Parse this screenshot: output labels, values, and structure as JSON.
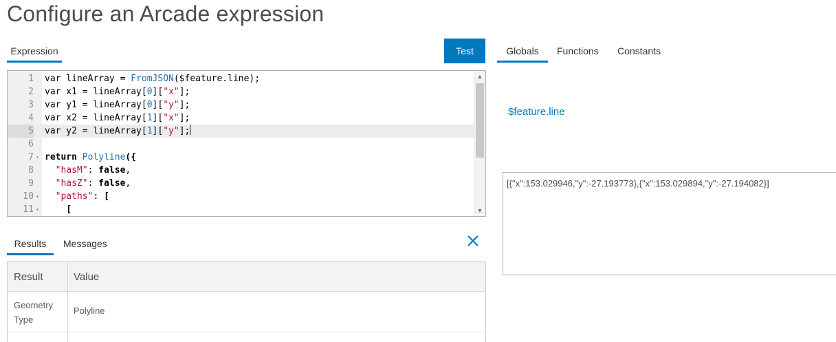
{
  "page": {
    "title": "Configure an Arcade expression"
  },
  "left_tabs": {
    "expression": "Expression",
    "test_button": "Test"
  },
  "editor": {
    "lines": [
      {
        "num": "1",
        "fold": "",
        "tokens": [
          {
            "t": "var lineArray = ",
            "c": ""
          },
          {
            "t": "FromJSON",
            "c": "fn"
          },
          {
            "t": "($feature.line);",
            "c": ""
          }
        ]
      },
      {
        "num": "2",
        "fold": "",
        "tokens": [
          {
            "t": "var x1 = lineArray[",
            "c": ""
          },
          {
            "t": "0",
            "c": "fn"
          },
          {
            "t": "][",
            "c": ""
          },
          {
            "t": "\"x\"",
            "c": "str"
          },
          {
            "t": "];",
            "c": ""
          }
        ]
      },
      {
        "num": "3",
        "fold": "",
        "tokens": [
          {
            "t": "var y1 = lineArray[",
            "c": ""
          },
          {
            "t": "0",
            "c": "fn"
          },
          {
            "t": "][",
            "c": ""
          },
          {
            "t": "\"y\"",
            "c": "str"
          },
          {
            "t": "];",
            "c": ""
          }
        ]
      },
      {
        "num": "4",
        "fold": "",
        "tokens": [
          {
            "t": "var x2 = lineArray[",
            "c": ""
          },
          {
            "t": "1",
            "c": "fn"
          },
          {
            "t": "][",
            "c": ""
          },
          {
            "t": "\"x\"",
            "c": "str"
          },
          {
            "t": "];",
            "c": ""
          }
        ]
      },
      {
        "num": "5",
        "fold": "",
        "current": true,
        "tokens": [
          {
            "t": "var y2 = lineArray[",
            "c": ""
          },
          {
            "t": "1",
            "c": "fn"
          },
          {
            "t": "][",
            "c": ""
          },
          {
            "t": "\"y\"",
            "c": "str"
          },
          {
            "t": "];",
            "c": ""
          }
        ]
      },
      {
        "num": "6",
        "fold": "",
        "tokens": []
      },
      {
        "num": "7",
        "fold": "▾",
        "tokens": [
          {
            "t": "return",
            "c": "kw"
          },
          {
            "t": " ",
            "c": ""
          },
          {
            "t": "Polyline",
            "c": "fn"
          },
          {
            "t": "({",
            "c": "kw"
          }
        ]
      },
      {
        "num": "8",
        "fold": "",
        "tokens": [
          {
            "t": "  ",
            "c": ""
          },
          {
            "t": "\"hasM\"",
            "c": "str"
          },
          {
            "t": ": ",
            "c": ""
          },
          {
            "t": "false",
            "c": "kw"
          },
          {
            "t": ",",
            "c": ""
          }
        ]
      },
      {
        "num": "9",
        "fold": "",
        "tokens": [
          {
            "t": "  ",
            "c": ""
          },
          {
            "t": "\"hasZ\"",
            "c": "str"
          },
          {
            "t": ": ",
            "c": ""
          },
          {
            "t": "false",
            "c": "kw"
          },
          {
            "t": ",",
            "c": ""
          }
        ]
      },
      {
        "num": "10",
        "fold": "▾",
        "tokens": [
          {
            "t": "  ",
            "c": ""
          },
          {
            "t": "\"paths\"",
            "c": "str"
          },
          {
            "t": ": ",
            "c": ""
          },
          {
            "t": "[",
            "c": "kw"
          }
        ]
      },
      {
        "num": "11",
        "fold": "▾",
        "tokens": [
          {
            "t": "    ",
            "c": ""
          },
          {
            "t": "[",
            "c": "kw"
          }
        ]
      }
    ]
  },
  "results_tabs": {
    "results": "Results",
    "messages": "Messages"
  },
  "results_table": {
    "headers": {
      "result": "Result",
      "value": "Value"
    },
    "rows": [
      {
        "key": "Geometry Type",
        "value": "Polyline"
      }
    ]
  },
  "right_tabs": {
    "globals": "Globals",
    "functions": "Functions",
    "constants": "Constants"
  },
  "globals": {
    "selected": "$feature.line",
    "value": "[{\"x\":153.029946,\"y\":-27.193773},{\"x\":153.029894,\"y\":-27.194082}]"
  },
  "colors": {
    "accent": "#0079c1",
    "string": "#b4123c",
    "function": "#1f6fb0"
  },
  "icons": {
    "close": "close-icon",
    "fold": "fold-arrow-icon"
  }
}
